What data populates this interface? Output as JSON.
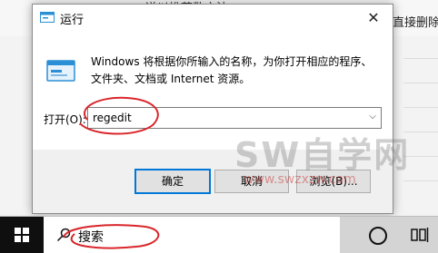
{
  "background": {
    "top_text": "遂以推荐数方法。",
    "right_text": "直接删除"
  },
  "dialog": {
    "title": "运行",
    "close_glyph": "✕",
    "description": "Windows 将根据你所输入的名称，为你打开相应的程序、文件夹、文档或 Internet 资源。",
    "open_label": "打开(O):",
    "open_value": "regedit",
    "ok_label": "确定",
    "cancel_label": "取消",
    "browse_label": "浏览(B)..."
  },
  "watermark": {
    "main": "SW自学网",
    "url": "www.swzxzw.com"
  },
  "taskbar": {
    "search_placeholder": "搜索"
  },
  "colors": {
    "accent": "#0078d7",
    "annotation_red": "#d9262b",
    "taskbar_start": "#0f0f0f"
  }
}
